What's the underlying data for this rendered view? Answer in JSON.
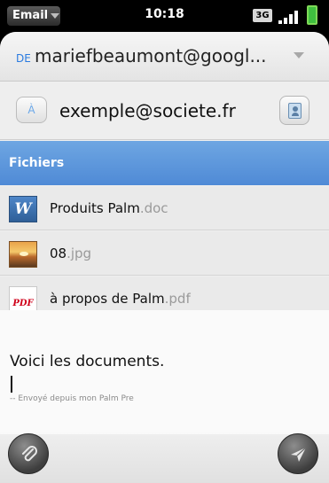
{
  "status_bar": {
    "app_menu_label": "Email",
    "time": "10:18",
    "network": "3G"
  },
  "compose": {
    "from_prefix": "DE",
    "from_address": "mariefbeaumont@googl...",
    "to_button_label": "À",
    "to_value": "exemple@societe.fr",
    "files_header": "Fichiers",
    "attachments": [
      {
        "name": "Produits Palm",
        "ext": ".doc",
        "icon": "word-doc-icon"
      },
      {
        "name": "08",
        "ext": ".jpg",
        "icon": "image-thumbnail-icon"
      },
      {
        "name": "à propos de Palm",
        "ext": ".pdf",
        "icon": "pdf-icon"
      }
    ],
    "body_text": "Voici les documents.",
    "signature": "-- Envoyé depuis mon Palm Pre"
  },
  "icons": {
    "attach": "paperclip-icon",
    "send": "paper-plane-icon",
    "contacts": "address-book-icon"
  },
  "colors": {
    "header_blue": "#5b95dc",
    "accent_blue": "#2a7be0"
  }
}
